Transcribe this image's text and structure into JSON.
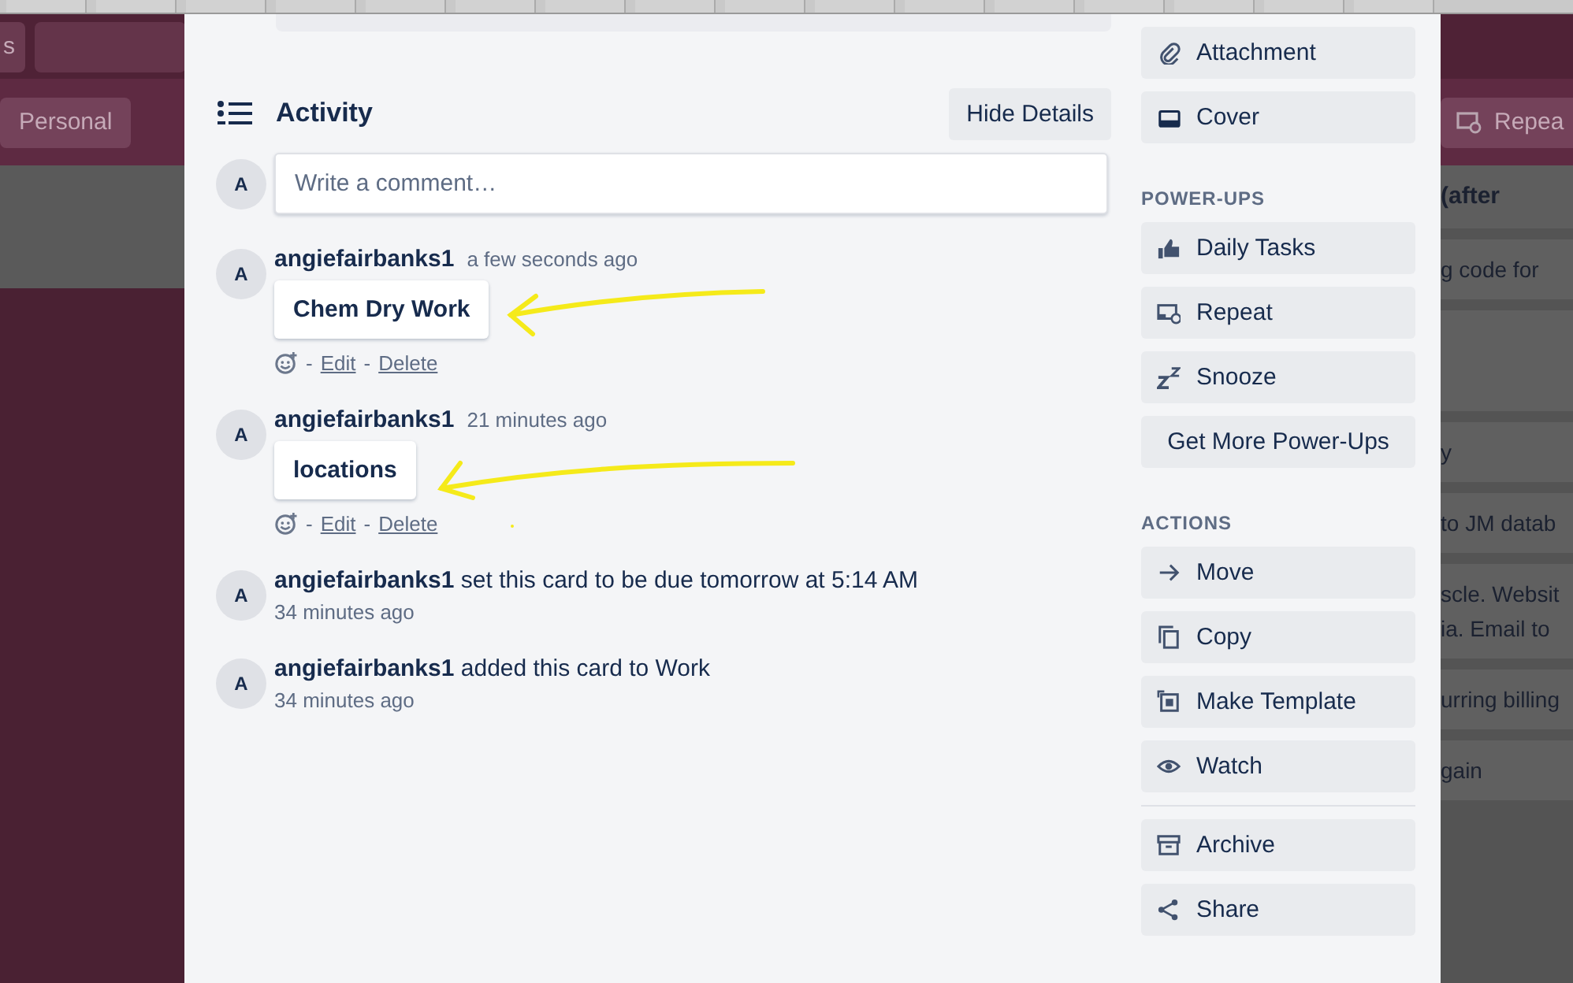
{
  "board": {
    "top_button": "s",
    "header_button": "Personal",
    "header_right_button": "Repea",
    "list": {
      "title": "(after",
      "cards": [
        {
          "kind": "text",
          "lines": [
            "g code for"
          ]
        },
        {
          "kind": "blank"
        },
        {
          "kind": "text",
          "lines": [
            "y"
          ]
        },
        {
          "kind": "text",
          "lines": [
            "to JM datab"
          ]
        },
        {
          "kind": "text",
          "lines": [
            "scle. Websit",
            "ia. Email to"
          ]
        },
        {
          "kind": "text",
          "lines": [
            "urring billing"
          ]
        },
        {
          "kind": "text",
          "lines": [
            "gain"
          ]
        }
      ]
    }
  },
  "activity": {
    "title": "Activity",
    "hide_details_button": "Hide Details",
    "comment_avatar": "A",
    "comment_placeholder": "Write a comment…",
    "entries": [
      {
        "kind": "comment",
        "avatar": "A",
        "author": "angiefairbanks1",
        "time": "a few seconds ago",
        "text": "Chem Dry Work",
        "separator": "-",
        "actions": [
          "Edit",
          "Delete"
        ]
      },
      {
        "kind": "comment",
        "avatar": "A",
        "author": "angiefairbanks1",
        "time": "21 minutes ago",
        "text": "locations",
        "separator": "-",
        "actions": [
          "Edit",
          "Delete"
        ]
      },
      {
        "kind": "event",
        "avatar": "A",
        "author": "angiefairbanks1",
        "text": "set this card to be due tomorrow at 5:14 AM",
        "time": "34 minutes ago"
      },
      {
        "kind": "event",
        "avatar": "A",
        "author": "angiefairbanks1",
        "text": "added this card to Work",
        "time": "34 minutes ago"
      }
    ]
  },
  "sidebar": {
    "sections": [
      {
        "buttons": [
          {
            "kind": "attachment",
            "label": "Attachment"
          },
          {
            "kind": "cover",
            "label": "Cover"
          }
        ]
      },
      {
        "heading": "POWER-UPS",
        "buttons": [
          {
            "kind": "thumb",
            "label": "Daily Tasks"
          },
          {
            "kind": "repeat",
            "label": "Repeat"
          },
          {
            "kind": "snooze",
            "label": "Snooze"
          },
          {
            "kind": "plain",
            "label": "Get More Power-Ups"
          }
        ]
      },
      {
        "heading": "ACTIONS",
        "buttons": [
          {
            "kind": "move",
            "label": "Move"
          },
          {
            "kind": "copy",
            "label": "Copy"
          },
          {
            "kind": "template",
            "label": "Make Template"
          },
          {
            "kind": "watch",
            "label": "Watch"
          }
        ]
      },
      {
        "buttons": [
          {
            "kind": "archive",
            "label": "Archive"
          },
          {
            "kind": "share",
            "label": "Share"
          }
        ]
      }
    ]
  }
}
